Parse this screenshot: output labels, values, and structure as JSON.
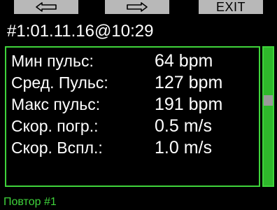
{
  "softkeys": {
    "left_icon": "arrow-left-icon",
    "middle_icon": "arrow-right-icon",
    "right_label": "EXIT"
  },
  "title": "#1:01.11.16@10:29",
  "stats": [
    {
      "label": "Мин пульс:",
      "value": "64 bpm"
    },
    {
      "label": "Сред. Пульс:",
      "value": "127 bpm"
    },
    {
      "label": "Макс пульс:",
      "value": "191 bpm"
    },
    {
      "label": "Скор. погр.:",
      "value": "0.5 m/s"
    },
    {
      "label": "Скор. Вспл.:",
      "value": "1.0 m/s"
    }
  ],
  "footer": "Повтор #1",
  "colors": {
    "accent": "#3fd33b",
    "background": "#000000",
    "softkey": "#b8b8b8",
    "scroll_thumb": "#9a9a9a"
  }
}
